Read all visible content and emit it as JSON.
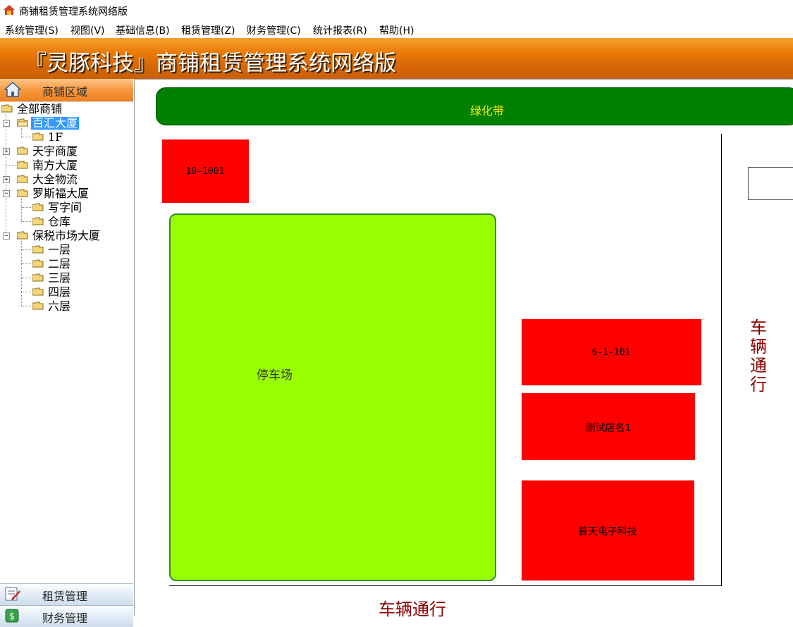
{
  "window": {
    "title": "商铺租赁管理系统网络版"
  },
  "menu": [
    "系统管理(S)",
    "视图(V)",
    "基础信息(B)",
    "租赁管理(Z)",
    "财务管理(C)",
    "统计报表(R)",
    "帮助(H)"
  ],
  "banner": {
    "title": "『灵豚科技』商铺租赁管理系统网络版"
  },
  "sidebar": {
    "header": "商铺区域",
    "tree": {
      "root": "全部商铺",
      "baihui": "百汇大厦",
      "baihui_1f": "1F",
      "tianyu": "天宇商厦",
      "nanfang": "南方大厦",
      "daquan": "大全物流",
      "luosifu": "罗斯福大厦",
      "luosifu_office": "写字间",
      "luosifu_warehouse": "仓库",
      "baoshui": "保税市场大厦",
      "floor1": "一层",
      "floor2": "二层",
      "floor3": "三层",
      "floor4": "四层",
      "floor6": "六层"
    },
    "selected": "百汇大厦",
    "bottom_tabs": [
      "租赁管理",
      "财务管理"
    ]
  },
  "map": {
    "green_belt": "绿化带",
    "parking": "停车场",
    "road_right": "车辆通行",
    "road_bottom": "车辆通行",
    "shops": {
      "s1": "10-1001",
      "s2": "6-1-101",
      "s3": "测试店名1",
      "s4": "普天电子科技"
    }
  },
  "colors": {
    "banner": "#e67a0a",
    "shop_occupied": "#ff0000",
    "parking": "#99ff00",
    "green_belt": "#008000",
    "road_text": "#8b0000",
    "selection": "#3399ff"
  }
}
